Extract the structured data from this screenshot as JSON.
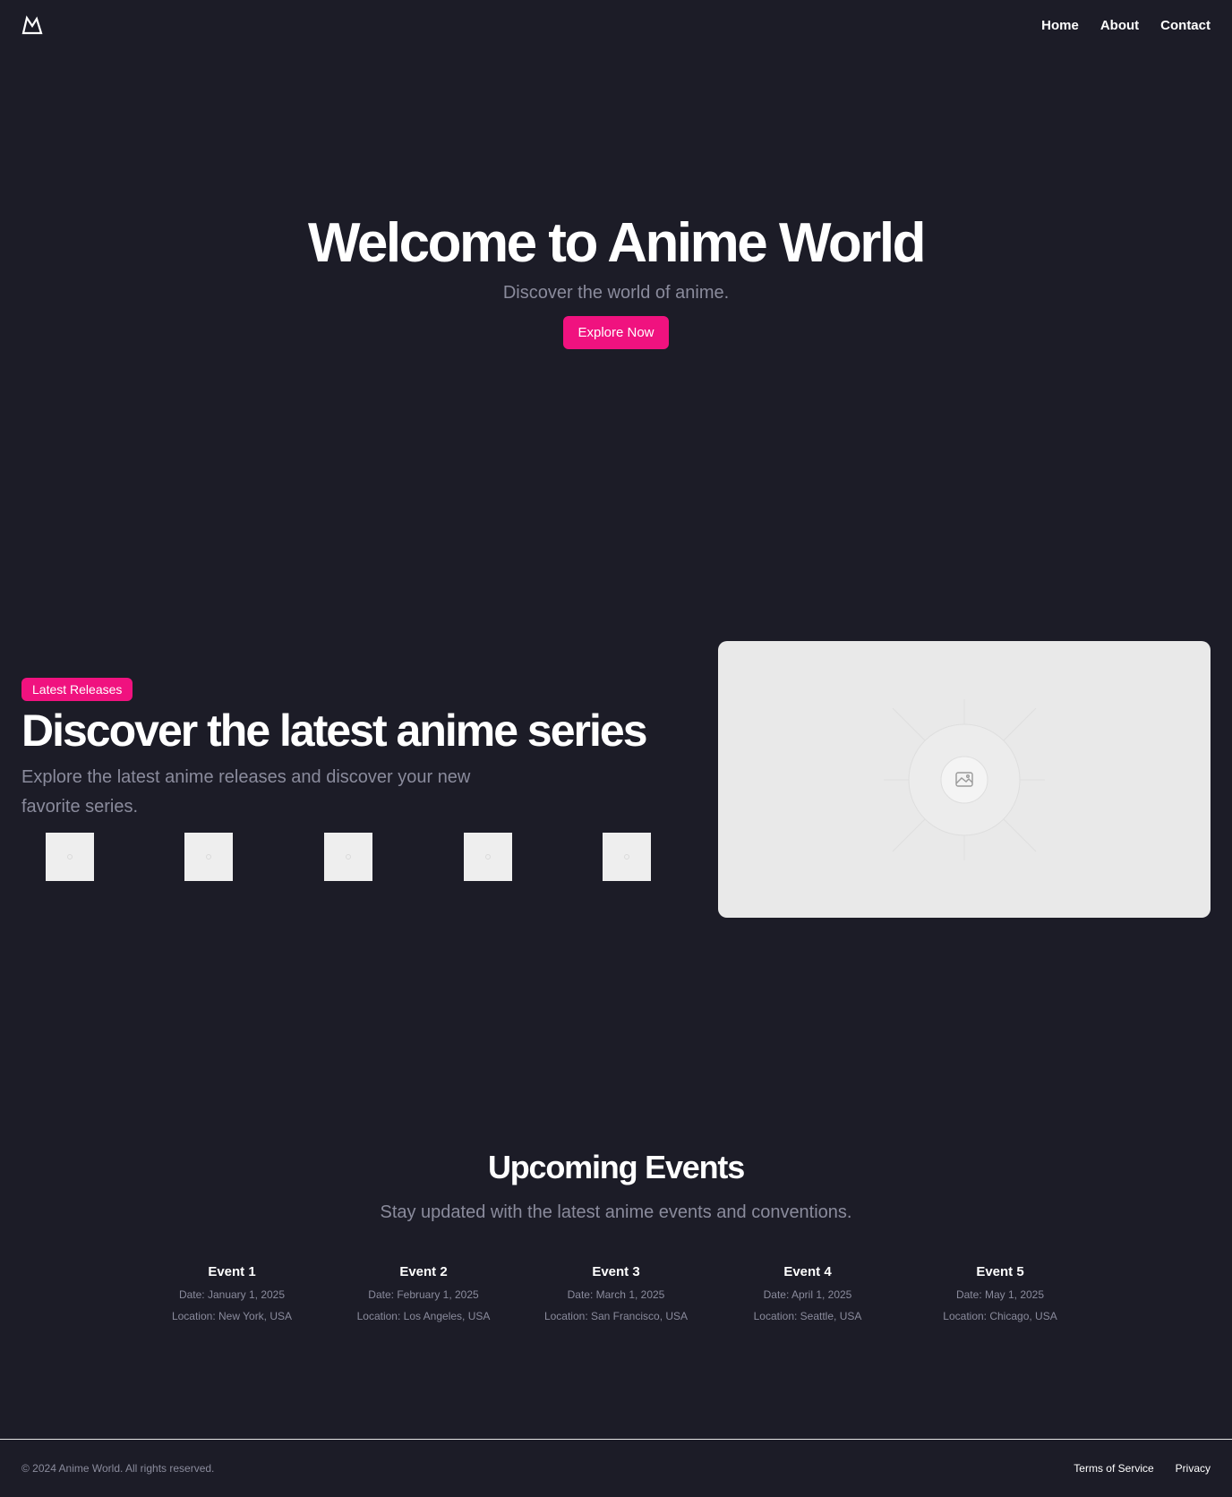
{
  "header": {
    "logo_icon": "mountain-logo-icon",
    "nav": [
      {
        "label": "Home"
      },
      {
        "label": "About"
      },
      {
        "label": "Contact"
      }
    ]
  },
  "hero": {
    "title": "Welcome to Anime World",
    "subtitle": "Discover the world of anime.",
    "button_label": "Explore Now"
  },
  "releases": {
    "badge": "Latest Releases",
    "title": "Discover the latest anime series",
    "description": "Explore the latest anime releases and discover your new favorite series.",
    "thumbnail_count": 5,
    "feature_image_icon": "image-placeholder-icon"
  },
  "events": {
    "title": "Upcoming Events",
    "subtitle": "Stay updated with the latest anime events and conventions.",
    "items": [
      {
        "name": "Event 1",
        "date": "Date: January 1, 2025",
        "location": "Location: New York, USA"
      },
      {
        "name": "Event 2",
        "date": "Date: February 1, 2025",
        "location": "Location: Los Angeles, USA"
      },
      {
        "name": "Event 3",
        "date": "Date: March 1, 2025",
        "location": "Location: San Francisco, USA"
      },
      {
        "name": "Event 4",
        "date": "Date: April 1, 2025",
        "location": "Location: Seattle, USA"
      },
      {
        "name": "Event 5",
        "date": "Date: May 1, 2025",
        "location": "Location: Chicago, USA"
      }
    ]
  },
  "footer": {
    "copyright": "© 2024 Anime World. All rights reserved.",
    "links": [
      {
        "label": "Terms of Service"
      },
      {
        "label": "Privacy"
      }
    ]
  },
  "colors": {
    "background": "#1c1c27",
    "accent": "#f0127f",
    "muted_text": "#8a8b9c",
    "placeholder": "#e9e9e9"
  }
}
